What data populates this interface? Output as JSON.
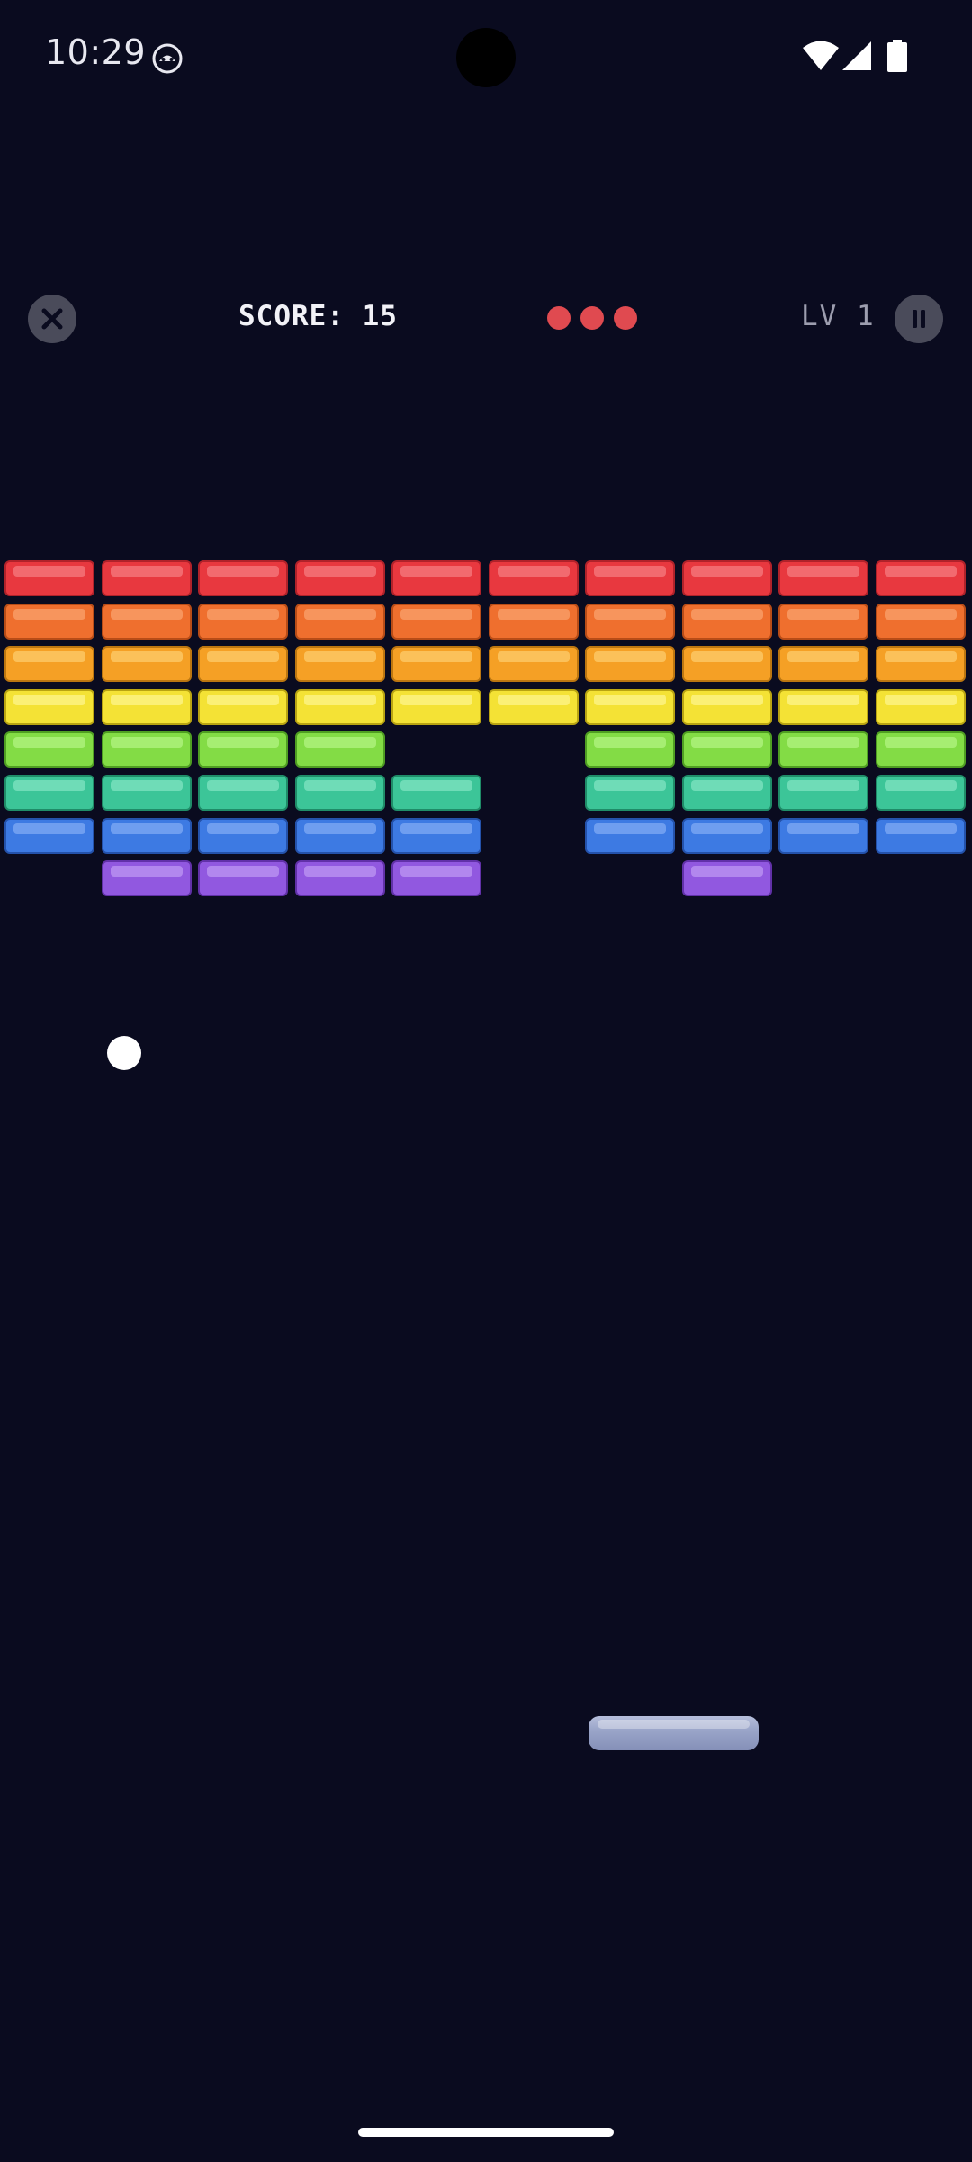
{
  "status_bar": {
    "time": "10:29",
    "icons": [
      "app-notification-icon",
      "wifi-icon",
      "cellular-signal-icon",
      "battery-icon"
    ]
  },
  "hud": {
    "score_text": "SCORE: 15",
    "level_text": "LV 1",
    "lives_remaining": 3,
    "close_icon": "close-icon",
    "pause_icon": "pause-icon"
  },
  "colors": {
    "background": "#0a0b1f",
    "life": "#e04a50",
    "ball": "#ffffff",
    "paddle": "#9aa5c9"
  },
  "bricks": {
    "columns": 10,
    "rows": [
      {
        "color": "red",
        "fill": "#e8383f",
        "shine": "#f26a6f",
        "border": "#b0222a",
        "present": [
          1,
          1,
          1,
          1,
          1,
          1,
          1,
          1,
          1,
          1
        ]
      },
      {
        "color": "orange",
        "fill": "#ef6f2e",
        "shine": "#f7955d",
        "border": "#b84c17",
        "present": [
          1,
          1,
          1,
          1,
          1,
          1,
          1,
          1,
          1,
          1
        ]
      },
      {
        "color": "amber",
        "fill": "#f5a025",
        "shine": "#fbc15a",
        "border": "#bc7610",
        "present": [
          1,
          1,
          1,
          1,
          1,
          1,
          1,
          1,
          1,
          1
        ]
      },
      {
        "color": "yellow",
        "fill": "#f4e235",
        "shine": "#fbf076",
        "border": "#b9a412",
        "present": [
          1,
          1,
          1,
          1,
          1,
          1,
          1,
          1,
          1,
          1
        ]
      },
      {
        "color": "green",
        "fill": "#83dc45",
        "shine": "#a6ee72",
        "border": "#4f9e22",
        "present": [
          1,
          1,
          1,
          1,
          0,
          0,
          1,
          1,
          1,
          1
        ]
      },
      {
        "color": "teal",
        "fill": "#3cc598",
        "shine": "#6fdcb7",
        "border": "#1f8c68",
        "present": [
          1,
          1,
          1,
          1,
          1,
          0,
          1,
          1,
          1,
          1
        ]
      },
      {
        "color": "blue",
        "fill": "#3d7ae3",
        "shine": "#6f9ef0",
        "border": "#2452ab",
        "present": [
          1,
          1,
          1,
          1,
          1,
          0,
          1,
          1,
          1,
          1
        ]
      },
      {
        "color": "purple",
        "fill": "#9158e0",
        "shine": "#b287ee",
        "border": "#6131a8",
        "present": [
          0,
          1,
          1,
          1,
          1,
          0,
          0,
          1,
          0,
          0
        ]
      }
    ]
  }
}
